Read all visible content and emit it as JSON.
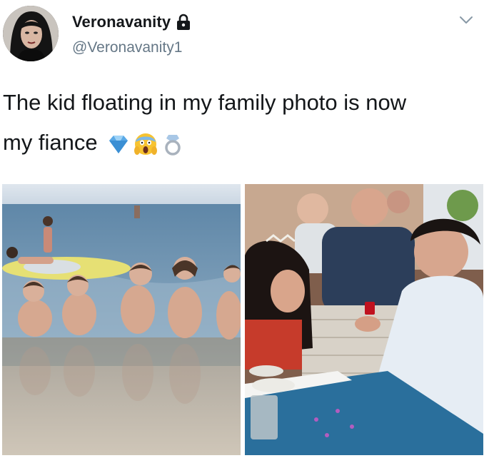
{
  "author": {
    "display_name": "Veronavanity",
    "handle": "@Veronavanity1",
    "avatar_icon": "profile-avatar",
    "protected_icon": "lock-icon"
  },
  "tweet": {
    "text_line1": "The kid floating in my family photo is now",
    "text_line2": "my fiance",
    "emojis": [
      "gem-stone",
      "face-screaming-in-fear",
      "ring"
    ]
  },
  "menu": {
    "icon": "chevron-down-icon"
  },
  "media": {
    "left_photo": "beach-family-photo",
    "right_photo": "restaurant-proposal-photo"
  },
  "colors": {
    "text": "#14171a",
    "secondary_text": "#657786"
  }
}
